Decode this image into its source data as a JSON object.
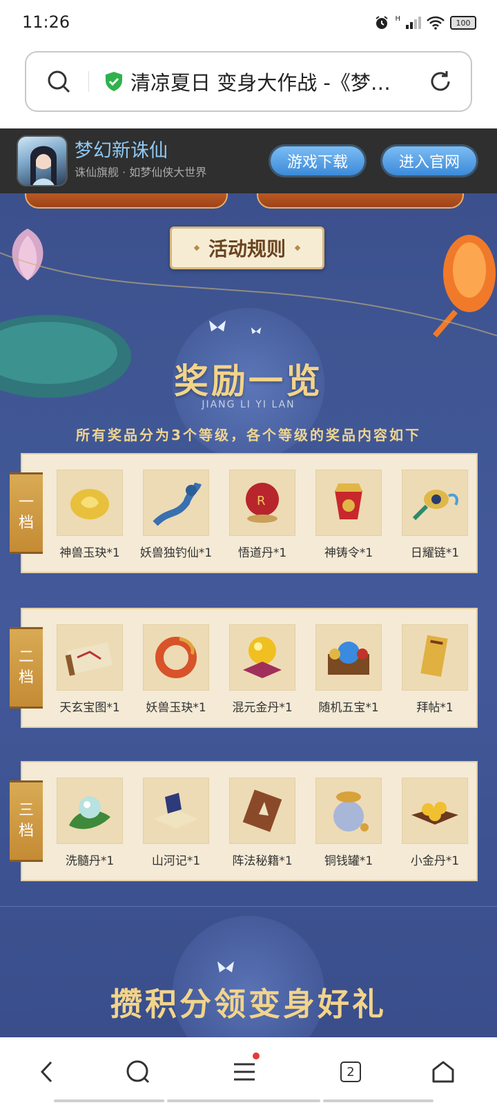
{
  "status": {
    "time": "11:26",
    "battery": "100",
    "network": "H"
  },
  "urlbar": {
    "title": "清凉夏日 变身大作战 -《梦…"
  },
  "game_bar": {
    "name": "梦幻新诛仙",
    "tagline": "诛仙旗舰 · 如梦仙侠大世界",
    "download_label": "游戏下载",
    "site_label": "进入官网"
  },
  "rules_label": "活动规则",
  "rewards": {
    "title": "奖励一览",
    "subtitle": "JIANG LI YI LAN",
    "description": "所有奖品分为3个等级，各个等级的奖品内容如下",
    "tiers": [
      {
        "label_top": "一",
        "label_bottom": "档",
        "items": [
          "神兽玉玦*1",
          "妖兽独钓仙*1",
          "悟道丹*1",
          "神铸令*1",
          "日耀链*1"
        ]
      },
      {
        "label_top": "二",
        "label_bottom": "档",
        "items": [
          "天玄宝图*1",
          "妖兽玉玦*1",
          "混元金丹*1",
          "随机五宝*1",
          "拜帖*1"
        ]
      },
      {
        "label_top": "三",
        "label_bottom": "档",
        "items": [
          "洗髓丹*1",
          "山河记*1",
          "阵法秘籍*1",
          "铜钱罐*1",
          "小金丹*1"
        ]
      }
    ]
  },
  "next_section_title": "攒积分领变身好礼",
  "nav": {
    "tabs_count": "2"
  },
  "colors": {
    "accent_gold": "#f2d48a",
    "page_blue": "#3f5693",
    "pill_blue": "#3c8ad8"
  }
}
